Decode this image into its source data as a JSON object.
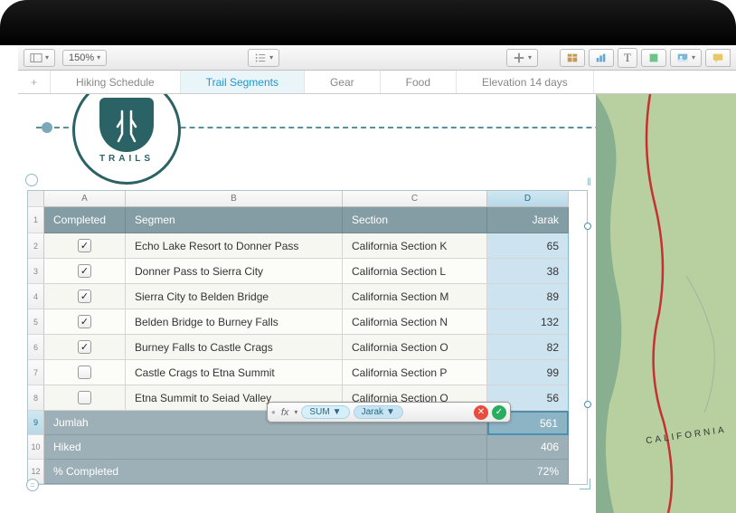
{
  "toolbar": {
    "zoom": "150%"
  },
  "tabs": [
    {
      "label": "Hiking Schedule",
      "active": false
    },
    {
      "label": "Trail Segments",
      "active": true
    },
    {
      "label": "Gear",
      "active": false
    },
    {
      "label": "Food",
      "active": false
    },
    {
      "label": "Elevation 14 days",
      "active": false
    }
  ],
  "logo": {
    "text": "TRAILS"
  },
  "columns": [
    "A",
    "B",
    "C",
    "D"
  ],
  "headers": {
    "a": "Completed",
    "b": "Segmen",
    "c": "Section",
    "d": "Jarak"
  },
  "rows": [
    {
      "n": "2",
      "done": true,
      "seg": "Echo Lake Resort to Donner Pass",
      "sec": "California Section K",
      "dist": "65"
    },
    {
      "n": "3",
      "done": true,
      "seg": "Donner Pass to Sierra City",
      "sec": "California Section L",
      "dist": "38"
    },
    {
      "n": "4",
      "done": true,
      "seg": "Sierra City to Belden Bridge",
      "sec": "California Section M",
      "dist": "89"
    },
    {
      "n": "5",
      "done": true,
      "seg": "Belden Bridge to Burney Falls",
      "sec": "California Section N",
      "dist": "132"
    },
    {
      "n": "6",
      "done": true,
      "seg": "Burney Falls to Castle Crags",
      "sec": "California Section O",
      "dist": "82"
    },
    {
      "n": "7",
      "done": false,
      "seg": "Castle Crags to Etna Summit",
      "sec": "California Section P",
      "dist": "99"
    },
    {
      "n": "8",
      "done": false,
      "seg": "Etna Summit to Seiad Valley",
      "sec": "California Section Q",
      "dist": "56"
    }
  ],
  "footers": [
    {
      "n": "9",
      "label": "Jumlah",
      "val": "561",
      "sel": true
    },
    {
      "n": "10",
      "label": "Hiked",
      "val": "406",
      "sel": false
    },
    {
      "n": "12",
      "label": "% Completed",
      "val": "72%",
      "sel": false
    }
  ],
  "formula": {
    "fn": "SUM",
    "arg": "Jarak"
  },
  "map": {
    "label": "CALIFORNIA"
  }
}
